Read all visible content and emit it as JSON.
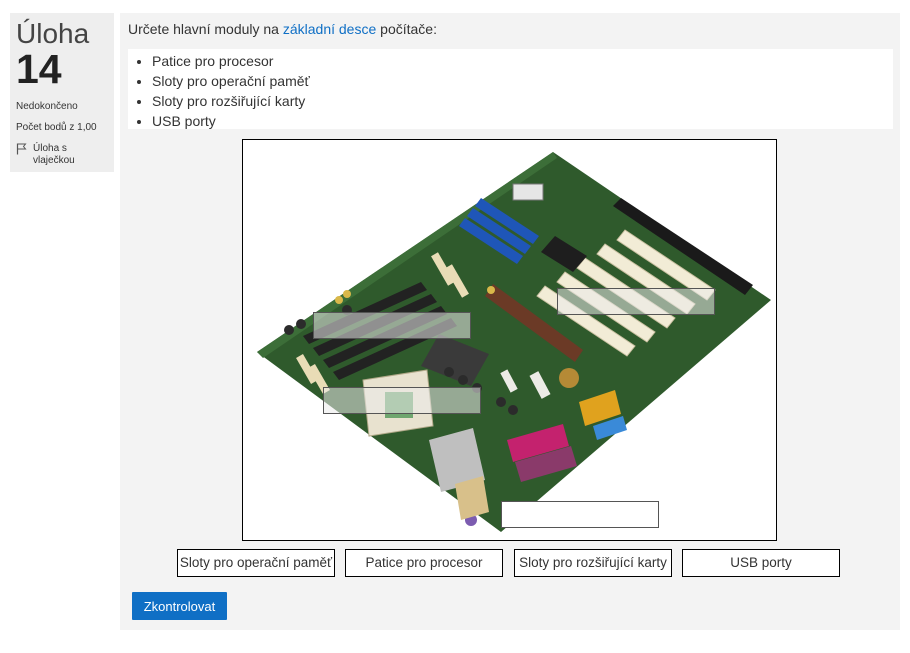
{
  "question_info": {
    "title_word": "Úloha",
    "number": "14",
    "state": "Nedokončeno",
    "grade": "Počet bodů z 1,00",
    "flag_label": "Úloha s vlaječkou"
  },
  "prompt": {
    "before_link": "Určete hlavní moduly na ",
    "link_text": "základní desce",
    "after_link": " počítače:"
  },
  "list_items": [
    "Patice pro procesor",
    "Sloty pro operační paměť",
    "Sloty pro rozšiřující karty",
    "USB porty"
  ],
  "image": {
    "subject": "motherboard photo",
    "colors": {
      "pcb": "#2f5a2c",
      "pci_slots": "#f2ecd6",
      "agp_slot": "#6b3a26",
      "ram_slots": "#222222",
      "blue_slots": "#1f56b8",
      "ports_magenta": "#c4226e",
      "ports_yellow": "#e0a21e"
    }
  },
  "draggables": [
    "Sloty pro operační paměť",
    "Patice pro procesor",
    "Sloty pro rozšiřující karty",
    "USB porty"
  ],
  "check_button": "Zkontrolovat",
  "colors": {
    "accent": "#0f6fc5",
    "info_background": "#eeeeee",
    "content_background": "#f3f3f3"
  }
}
